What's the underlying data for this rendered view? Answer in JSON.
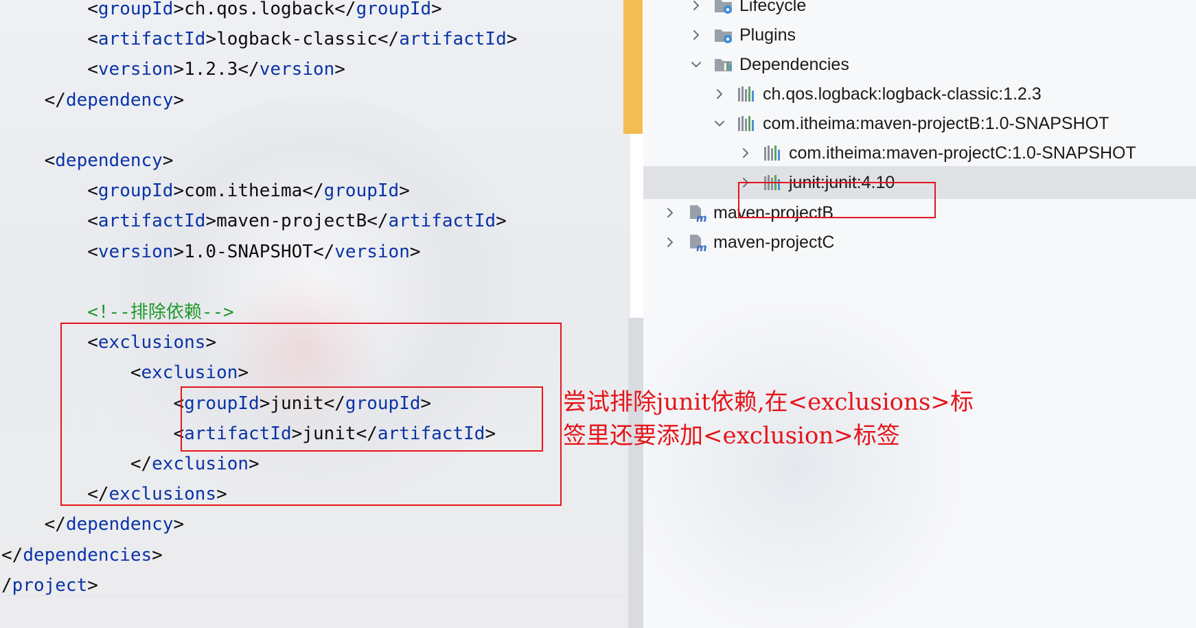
{
  "editor": {
    "lines": [
      {
        "indent": "        ",
        "parts": [
          {
            "t": "<"
          },
          {
            "t": "groupId",
            "tag": true
          },
          {
            "t": ">ch.qos.logback</"
          },
          {
            "t": "groupId",
            "tag": true
          },
          {
            "t": ">"
          }
        ]
      },
      {
        "indent": "        ",
        "parts": [
          {
            "t": "<"
          },
          {
            "t": "artifactId",
            "tag": true
          },
          {
            "t": ">logback-classic</"
          },
          {
            "t": "artifactId",
            "tag": true
          },
          {
            "t": ">"
          }
        ]
      },
      {
        "indent": "        ",
        "parts": [
          {
            "t": "<"
          },
          {
            "t": "version",
            "tag": true
          },
          {
            "t": ">1.2.3</"
          },
          {
            "t": "version",
            "tag": true
          },
          {
            "t": ">"
          }
        ]
      },
      {
        "indent": "    ",
        "parts": [
          {
            "t": "</"
          },
          {
            "t": "dependency",
            "tag": true
          },
          {
            "t": ">"
          }
        ]
      },
      {
        "indent": "",
        "parts": []
      },
      {
        "indent": "    ",
        "parts": [
          {
            "t": "<"
          },
          {
            "t": "dependency",
            "tag": true
          },
          {
            "t": ">"
          }
        ]
      },
      {
        "indent": "        ",
        "parts": [
          {
            "t": "<"
          },
          {
            "t": "groupId",
            "tag": true
          },
          {
            "t": ">com.itheima</"
          },
          {
            "t": "groupId",
            "tag": true
          },
          {
            "t": ">"
          }
        ]
      },
      {
        "indent": "        ",
        "parts": [
          {
            "t": "<"
          },
          {
            "t": "artifactId",
            "tag": true
          },
          {
            "t": ">maven-projectB</"
          },
          {
            "t": "artifactId",
            "tag": true
          },
          {
            "t": ">"
          }
        ]
      },
      {
        "indent": "        ",
        "parts": [
          {
            "t": "<"
          },
          {
            "t": "version",
            "tag": true
          },
          {
            "t": ">1.0-SNAPSHOT</"
          },
          {
            "t": "version",
            "tag": true
          },
          {
            "t": ">"
          }
        ]
      },
      {
        "indent": "",
        "parts": []
      },
      {
        "indent": "        ",
        "parts": [
          {
            "t": "<!--排除依赖-->",
            "comment": true
          }
        ]
      },
      {
        "indent": "        ",
        "parts": [
          {
            "t": "<"
          },
          {
            "t": "exclusions",
            "tag": true
          },
          {
            "t": ">"
          }
        ]
      },
      {
        "indent": "            ",
        "parts": [
          {
            "t": "<"
          },
          {
            "t": "exclusion",
            "tag": true
          },
          {
            "t": ">"
          }
        ]
      },
      {
        "indent": "                ",
        "parts": [
          {
            "t": "<"
          },
          {
            "t": "groupId",
            "tag": true
          },
          {
            "t": ">junit</"
          },
          {
            "t": "groupId",
            "tag": true
          },
          {
            "t": ">"
          }
        ]
      },
      {
        "indent": "                ",
        "parts": [
          {
            "t": "<"
          },
          {
            "t": "artifactId",
            "tag": true
          },
          {
            "t": ">junit</"
          },
          {
            "t": "artifactId",
            "tag": true
          },
          {
            "t": ">"
          }
        ]
      },
      {
        "indent": "            ",
        "parts": [
          {
            "t": "</"
          },
          {
            "t": "exclusion",
            "tag": true
          },
          {
            "t": ">"
          }
        ]
      },
      {
        "indent": "        ",
        "parts": [
          {
            "t": "</"
          },
          {
            "t": "exclusions",
            "tag": true
          },
          {
            "t": ">"
          }
        ]
      },
      {
        "indent": "    ",
        "parts": [
          {
            "t": "</"
          },
          {
            "t": "dependency",
            "tag": true
          },
          {
            "t": ">"
          }
        ]
      },
      {
        "indent": "",
        "parts": [
          {
            "t": "</"
          },
          {
            "t": "dependencies",
            "tag": true
          },
          {
            "t": ">"
          }
        ]
      },
      {
        "indent": "",
        "parts": [
          {
            "t": "/"
          },
          {
            "t": "project",
            "tag": true
          },
          {
            "t": ">"
          }
        ]
      }
    ]
  },
  "tree": {
    "items": [
      {
        "label": "Lifecycle",
        "icon": "folder-gear-icon",
        "chevron": "right",
        "selected": false
      },
      {
        "label": "Plugins",
        "icon": "folder-gear-icon",
        "chevron": "right",
        "selected": false
      },
      {
        "label": "Dependencies",
        "icon": "folder-library-icon",
        "chevron": "down",
        "selected": false
      },
      {
        "label": "ch.qos.logback:logback-classic:1.2.3",
        "icon": "library-icon",
        "chevron": "right",
        "selected": false
      },
      {
        "label": "com.itheima:maven-projectB:1.0-SNAPSHOT",
        "icon": "library-icon",
        "chevron": "down",
        "selected": false
      },
      {
        "label": "com.itheima:maven-projectC:1.0-SNAPSHOT",
        "icon": "library-icon",
        "chevron": "right",
        "selected": false
      },
      {
        "label": "junit:junit:4.10",
        "icon": "library-icon",
        "chevron": "right",
        "selected": true
      },
      {
        "label": "maven-projectB",
        "icon": "maven-module-icon",
        "chevron": "right",
        "selected": false
      },
      {
        "label": "maven-projectC",
        "icon": "maven-module-icon",
        "chevron": "right",
        "selected": false
      }
    ]
  },
  "annotation": {
    "line1": "尝试排除junit依赖,在<exclusions>标",
    "line2": "签里还要添加<exclusion>标签"
  },
  "colors": {
    "tag": "#0a33a6",
    "comment": "#1f9a2a",
    "annotation": "#e5141a",
    "scroll_thumb": "#f2bd52"
  }
}
